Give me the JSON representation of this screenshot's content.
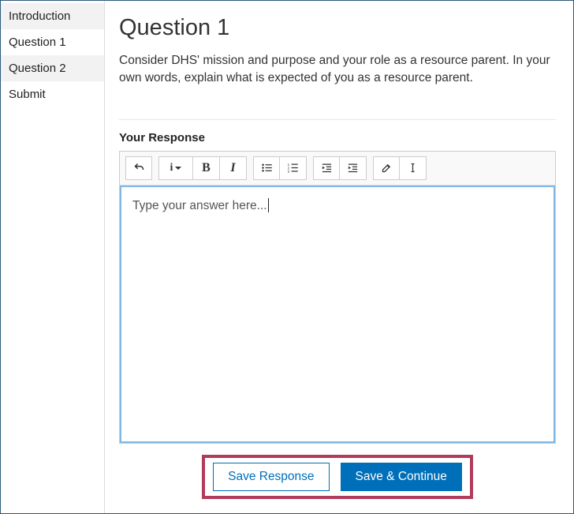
{
  "sidebar": {
    "items": [
      {
        "label": "Introduction"
      },
      {
        "label": "Question 1"
      },
      {
        "label": "Question 2"
      },
      {
        "label": "Submit"
      }
    ]
  },
  "main": {
    "title": "Question 1",
    "prompt": "Consider DHS' mission and purpose and your role as a resource parent. In your own words, explain what is expected of you as a resource parent.",
    "response_label": "Your Response",
    "editor_placeholder": "Type your answer here..."
  },
  "actions": {
    "save": "Save Response",
    "save_continue": "Save & Continue"
  }
}
